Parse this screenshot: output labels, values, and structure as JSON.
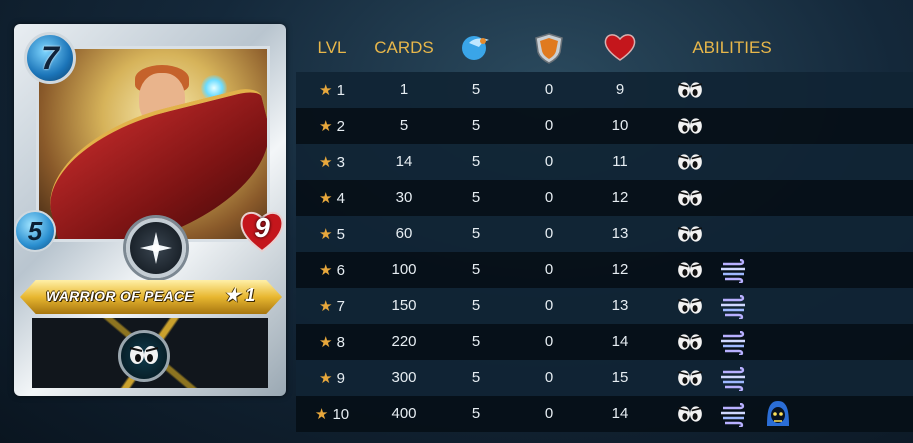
{
  "card": {
    "name": "WARRIOR OF PEACE",
    "level_star": "★",
    "level": "1",
    "mana": "7",
    "speed": "5",
    "health": "9",
    "icons": [
      "silence-icon",
      "star-emblem-icon"
    ],
    "colors": {
      "cape": "#c42b2b",
      "gold": "#e8b730",
      "mana": "#1b74b8",
      "health": "#c4161c"
    }
  },
  "table": {
    "headers": {
      "level": "LVL",
      "cards": "CARDS",
      "speed_icon": "speed-icon",
      "armor_icon": "armor-icon",
      "health_icon": "health-icon",
      "abilities": "ABILITIES"
    },
    "header_color": "#e8b74a",
    "rows": [
      {
        "star": "★",
        "lvl": "1",
        "cards": "1",
        "speed": "5",
        "armor": "0",
        "health": "9",
        "abilities": [
          "silence-icon"
        ]
      },
      {
        "star": "★",
        "lvl": "2",
        "cards": "5",
        "speed": "5",
        "armor": "0",
        "health": "10",
        "abilities": [
          "silence-icon"
        ]
      },
      {
        "star": "★",
        "lvl": "3",
        "cards": "14",
        "speed": "5",
        "armor": "0",
        "health": "11",
        "abilities": [
          "silence-icon"
        ]
      },
      {
        "star": "★",
        "lvl": "4",
        "cards": "30",
        "speed": "5",
        "armor": "0",
        "health": "12",
        "abilities": [
          "silence-icon"
        ]
      },
      {
        "star": "★",
        "lvl": "5",
        "cards": "60",
        "speed": "5",
        "armor": "0",
        "health": "13",
        "abilities": [
          "silence-icon"
        ]
      },
      {
        "star": "★",
        "lvl": "6",
        "cards": "100",
        "speed": "5",
        "armor": "0",
        "health": "12",
        "abilities": [
          "silence-icon",
          "wind-icon"
        ]
      },
      {
        "star": "★",
        "lvl": "7",
        "cards": "150",
        "speed": "5",
        "armor": "0",
        "health": "13",
        "abilities": [
          "silence-icon",
          "wind-icon"
        ]
      },
      {
        "star": "★",
        "lvl": "8",
        "cards": "220",
        "speed": "5",
        "armor": "0",
        "health": "14",
        "abilities": [
          "silence-icon",
          "wind-icon"
        ]
      },
      {
        "star": "★",
        "lvl": "9",
        "cards": "300",
        "speed": "5",
        "armor": "0",
        "health": "15",
        "abilities": [
          "silence-icon",
          "wind-icon"
        ]
      },
      {
        "star": "★",
        "lvl": "10",
        "cards": "400",
        "speed": "5",
        "armor": "0",
        "health": "14",
        "abilities": [
          "silence-icon",
          "wind-icon",
          "hooded-skull-icon"
        ]
      }
    ]
  }
}
